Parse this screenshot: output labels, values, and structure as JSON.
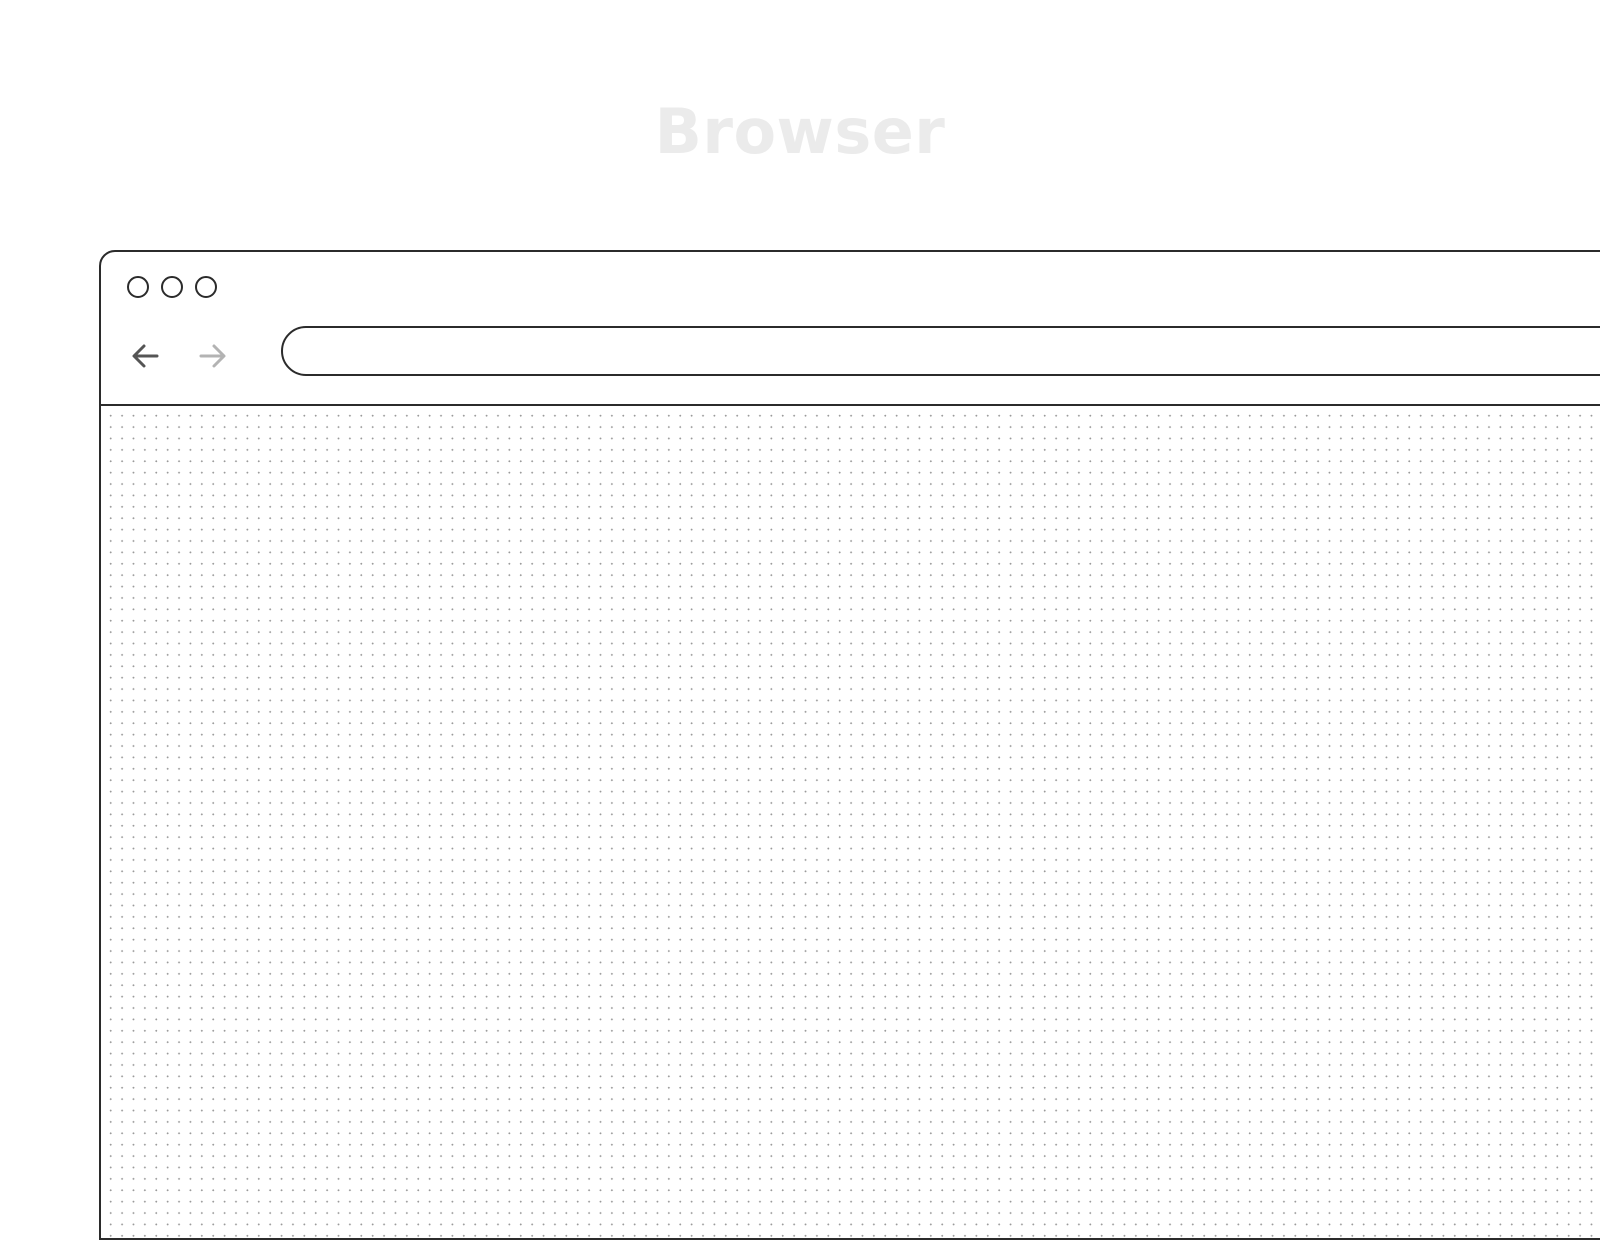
{
  "page": {
    "heading": "Browser"
  },
  "browser": {
    "window_controls": [
      "close",
      "minimize",
      "maximize"
    ],
    "toolbar": {
      "back_icon": "arrow-left-icon",
      "forward_icon": "arrow-right-icon",
      "address": {
        "value": "",
        "placeholder": ""
      }
    },
    "content": {
      "background": "dot-grid"
    }
  },
  "colors": {
    "outline": "#2b2b2b",
    "heading": "#ebebeb",
    "back_arrow": "#555555",
    "forward_arrow": "#b3b3b3",
    "dot": "#9a9a9a"
  }
}
